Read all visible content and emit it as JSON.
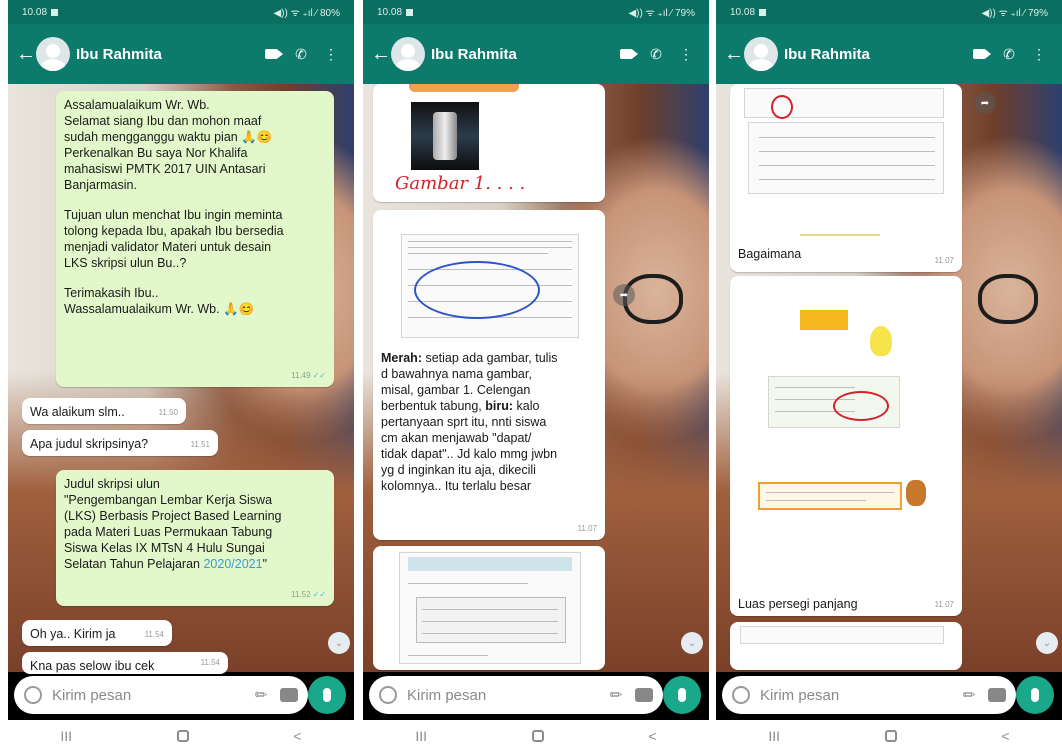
{
  "status": {
    "time": "10.08",
    "p1_signal": "◀)) ᯤ ₊ıl ⁄ 80%",
    "p2_signal": "◀)) ᯤ ₊ıl ⁄ 79%",
    "p3_signal": "◀)) ᯤ ₊ıl ⁄ 79%"
  },
  "contact": {
    "name": "Ibu Rahmita"
  },
  "icons": {
    "back": "arrow-back-icon",
    "video": "video-call-icon",
    "call": "phone-icon",
    "menu": "more-vert-icon"
  },
  "colors": {
    "header": "#0c7b6c",
    "outgoing": "#e2f8cb",
    "incoming": "#ffffff",
    "accent": "#19a889"
  },
  "p1": {
    "m1": {
      "l1": "Assalamualaikum Wr. Wb.",
      "l2": "Selamat siang Ibu dan mohon maaf",
      "l3": "sudah mengganggu waktu pian 🙏😊",
      "l4": "Perkenalkan Bu saya Nor Khalifa",
      "l5": "mahasiswi PMTK 2017 UIN Antasari",
      "l6": "Banjarmasin.",
      "l7": "Tujuan ulun menchat Ibu ingin meminta",
      "l8": "tolong kepada Ibu, apakah Ibu bersedia",
      "l9": "menjadi validator Materi untuk desain",
      "l10": "LKS skripsi ulun Bu..?",
      "l11": "Terimakasih Ibu..",
      "l12": "Wassalamualaikum Wr. Wb. 🙏😊",
      "time": "11.49"
    },
    "m2": {
      "text": "Wa alaikum slm..",
      "time": "11.50"
    },
    "m3": {
      "text": "Apa judul skripsinya?",
      "time": "11.51"
    },
    "m4": {
      "l1": "Judul skripsi ulun",
      "l2": "\"Pengembangan Lembar Kerja Siswa",
      "l3": "(LKS) Berbasis Project Based Learning",
      "l4": "pada Materi Luas Permukaan Tabung",
      "l5": "Siswa Kelas IX MTsN 4 Hulu Sungai",
      "l6": "Selatan Tahun Pelajaran ",
      "l6b": "2020/2021",
      "l6c": "\"",
      "time": "11.52"
    },
    "m5": {
      "text": "Oh ya.. Kirim ja",
      "time": "11.54"
    },
    "m6": {
      "text": "Kna pas selow ibu cek",
      "time": "11.54"
    }
  },
  "p2": {
    "handwriting": "Gambar 1. . . .",
    "m1": {
      "bold1": "Merah:",
      "l1": " setiap ada gambar,  tulis",
      "l2": "d bawahnya nama gambar,",
      "l3": "misal, gambar 1. Celengan",
      "l4a": "berbentuk tabung, ",
      "bold2": "biru:",
      "l4b": " kalo",
      "l5": "pertanyaan sprt  itu,  nnti siswa",
      "l6": "cm akan menjawab \"dapat/",
      "l7": "tidak dapat\".. Jd kalo mmg jwbn",
      "l8": "yg d inginkan itu aja, dikecili",
      "l9": "kolomnya.. Itu terlalu besar",
      "time": "11.07"
    }
  },
  "p3": {
    "m1": {
      "text": "Bagaimana",
      "time": "11.07"
    },
    "m2": {
      "text": "Luas persegi panjang",
      "time": "11.07"
    }
  },
  "input": {
    "placeholder": "Kirim pesan"
  },
  "nav": {
    "recent": "III",
    "back": "<"
  }
}
